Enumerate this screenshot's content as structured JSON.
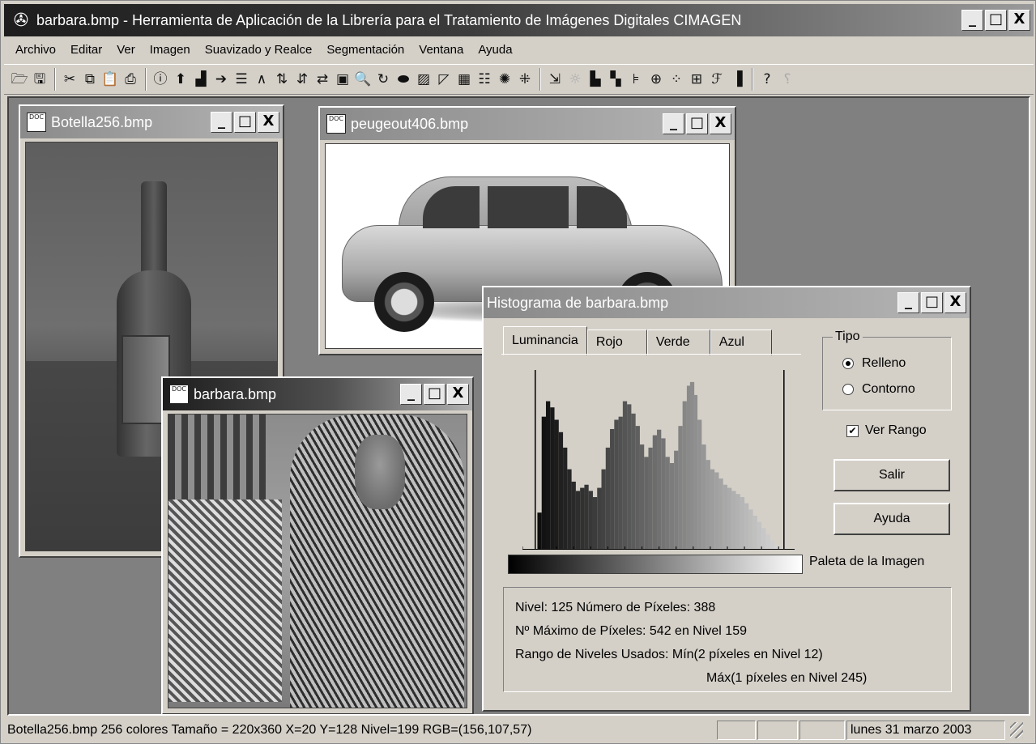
{
  "app": {
    "title": "barbara.bmp - Herramienta de Aplicación de la Librería para el Tratamiento de Imágenes Digitales CIMAGEN",
    "icon": "app-swirl-icon",
    "window_buttons": [
      "_",
      "□",
      "X"
    ]
  },
  "menu": [
    "Archivo",
    "Editar",
    "Ver",
    "Imagen",
    "Suavizado y Realce",
    "Segmentación",
    "Ventana",
    "Ayuda"
  ],
  "toolbar": {
    "groups": [
      [
        "open-icon",
        "save-icon"
      ],
      [
        "cut-icon",
        "copy-icon",
        "paste-icon",
        "print-icon"
      ],
      [
        "info-icon",
        "arrow-up-icon",
        "histogram-icon",
        "arrow-right-icon",
        "list-icon",
        "and-or-icon",
        "swap-icon",
        "sort-icon",
        "exchange-icon",
        "image-icon",
        "zoom-icon",
        "rotate-icon",
        "ellipse-icon",
        "texture-icon",
        "curve-icon",
        "grid-icon",
        "stripes-icon",
        "noise-icon",
        "pattern-icon"
      ],
      [
        "export-icon",
        "sun-icon",
        "bars-icon",
        "bars2-icon",
        "align-icon",
        "filter-icon",
        "dots-icon",
        "table-icon",
        "fft-icon",
        "gradient-icon"
      ],
      [
        "help-icon",
        "whatsthis-icon"
      ]
    ],
    "glyphs": {
      "open-icon": "🗁",
      "save-icon": "🖫",
      "cut-icon": "✂",
      "copy-icon": "⧉",
      "paste-icon": "📋",
      "print-icon": "⎙",
      "info-icon": "ⓘ",
      "arrow-up-icon": "⬆",
      "histogram-icon": "▟",
      "arrow-right-icon": "➔",
      "list-icon": "☰",
      "and-or-icon": "∧",
      "swap-icon": "⇅",
      "sort-icon": "⇵",
      "exchange-icon": "⇄",
      "image-icon": "▣",
      "zoom-icon": "🔍",
      "rotate-icon": "↻",
      "ellipse-icon": "⬬",
      "texture-icon": "▨",
      "curve-icon": "◸",
      "grid-icon": "▦",
      "stripes-icon": "☷",
      "noise-icon": "✺",
      "pattern-icon": "⁜",
      "export-icon": "⇲",
      "sun-icon": "☼",
      "bars-icon": "▙",
      "bars2-icon": "▚",
      "align-icon": "⊧",
      "filter-icon": "⊕",
      "dots-icon": "⁘",
      "table-icon": "⊞",
      "fft-icon": "ℱ",
      "gradient-icon": "▐",
      "help-icon": "?",
      "whatsthis-icon": "⸮"
    }
  },
  "windows": {
    "botella": {
      "title": "Botella256.bmp"
    },
    "peugeot": {
      "title": "peugeout406.bmp"
    },
    "barbara": {
      "title": "barbara.bmp"
    }
  },
  "histogram": {
    "title": "Histograma de barbara.bmp",
    "tabs": [
      "Luminancia",
      "Rojo",
      "Verde",
      "Azul"
    ],
    "active_tab": "Luminancia",
    "tipo_label": "Tipo",
    "tipo_options": [
      "Relleno",
      "Contorno"
    ],
    "tipo_selected": "Relleno",
    "ver_rango_label": "Ver Rango",
    "ver_rango_checked": true,
    "salir_label": "Salir",
    "ayuda_label": "Ayuda",
    "palette_label": "Paleta de la Imagen",
    "info": {
      "line1": "Nivel: 125  Número de Píxeles: 388",
      "line2": "Nº Máximo de Píxeles: 542 en Nivel 159",
      "line3": "Rango de Niveles Usados: Mín(2 píxeles en Nivel 12)",
      "line4": "Máx(1 píxeles en Nivel 245)"
    }
  },
  "chart_data": {
    "type": "area",
    "xlim": [
      0,
      255
    ],
    "ylim": [
      0,
      560
    ],
    "range_markers": [
      12,
      245
    ],
    "x": [
      12,
      16,
      20,
      24,
      28,
      32,
      36,
      40,
      44,
      48,
      52,
      56,
      60,
      64,
      68,
      72,
      76,
      80,
      84,
      88,
      92,
      96,
      100,
      104,
      108,
      112,
      116,
      120,
      124,
      128,
      132,
      136,
      140,
      144,
      148,
      152,
      156,
      159,
      162,
      166,
      170,
      174,
      178,
      182,
      186,
      190,
      194,
      198,
      202,
      206,
      210,
      214,
      218,
      222,
      226,
      230,
      234,
      238,
      242,
      245
    ],
    "values": [
      2,
      120,
      430,
      480,
      460,
      420,
      380,
      330,
      260,
      220,
      190,
      200,
      210,
      190,
      170,
      200,
      260,
      330,
      390,
      420,
      430,
      480,
      470,
      440,
      400,
      340,
      300,
      330,
      370,
      388,
      360,
      300,
      280,
      320,
      400,
      480,
      530,
      542,
      500,
      420,
      340,
      290,
      260,
      250,
      230,
      210,
      200,
      190,
      180,
      170,
      150,
      130,
      110,
      90,
      70,
      50,
      30,
      15,
      5,
      1
    ]
  },
  "statusbar": {
    "main": "Botella256.bmp  256 colores  Tamaño =  220x360   X=20  Y=128  Nivel=199  RGB=(156,107,57)",
    "date": "lunes 31 marzo 2003"
  }
}
